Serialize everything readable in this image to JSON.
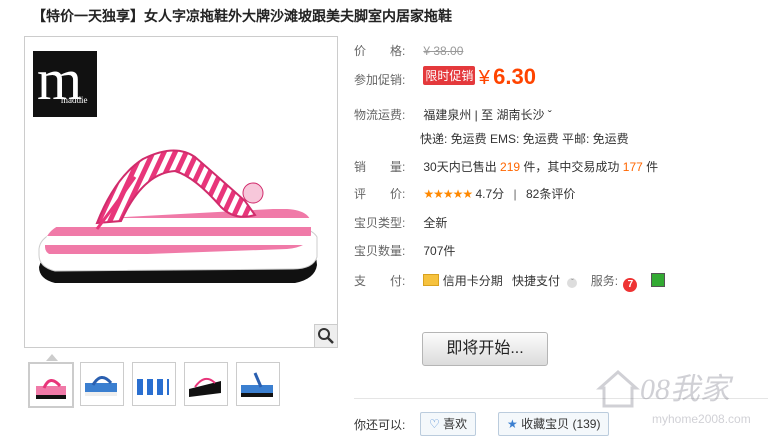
{
  "title": "【特价一天独享】女人字凉拖鞋外大牌沙滩坡跟美夫脚室内居家拖鞋",
  "brand": {
    "letter": "m",
    "word": "maddie"
  },
  "price": {
    "label": "价　　格:",
    "original": "¥ 38.00"
  },
  "promo": {
    "label": "参加促销:",
    "tag": "限时促销",
    "currency": "¥",
    "value": "6.30"
  },
  "shipping": {
    "label": "物流运费:",
    "route": "福建泉州 | 至  湖南长沙 ˇ",
    "fees": "快递: 免运费   EMS: 免运费   平邮: 免运费"
  },
  "sales": {
    "label": "销　　量:",
    "prefix": "30天内已售出",
    "sold": "219",
    "mid": "件，其中交易成功",
    "success": "177",
    "suffix": "件"
  },
  "rating": {
    "label": "评　　价:",
    "stars": "★★★★★",
    "score": "4.7分",
    "divider": "|",
    "reviews": "82条评价"
  },
  "type": {
    "label": "宝贝类型:",
    "value": "全新"
  },
  "quantity": {
    "label": "宝贝数量:",
    "value": "707件"
  },
  "payment": {
    "label": "支　　付:",
    "card": "信用卡分期",
    "quick": "快捷支付",
    "service_label": "服务:"
  },
  "buy_button": "即将开始...",
  "actions": {
    "label": "你还可以:",
    "like": "喜欢",
    "collect": "收藏宝贝 (139)"
  },
  "watermark": {
    "main": "08我家",
    "sub": "myhome2008.com"
  },
  "colors": {
    "accent": "#f40",
    "promo": "#e4393c",
    "pink": "#e8357a"
  },
  "icons": [
    "zoom-icon",
    "card-icon",
    "heart-icon",
    "star-icon",
    "service-7-icon",
    "service-check-icon"
  ]
}
